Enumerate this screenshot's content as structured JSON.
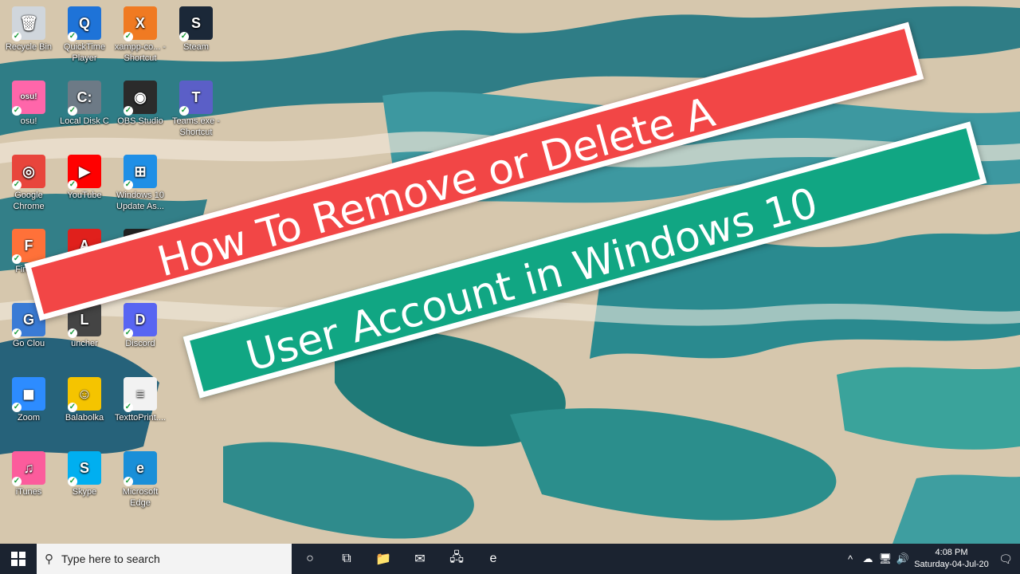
{
  "desktop": {
    "icons": [
      {
        "label": "Recycle Bin",
        "icon": "recycle-bin-icon",
        "color": "#d0d6dc",
        "glyph": "🗑"
      },
      {
        "label": "QuickTime Player",
        "icon": "quicktime-icon",
        "color": "#1e73d8",
        "glyph": "Q"
      },
      {
        "label": "xampp-co... - Shortcut",
        "icon": "xampp-icon",
        "color": "#f07a22",
        "glyph": "X"
      },
      {
        "label": "Steam",
        "icon": "steam-icon",
        "color": "#1b2838",
        "glyph": "S"
      },
      {
        "label": "osu!",
        "icon": "osu-icon",
        "color": "#ff66aa",
        "glyph": "osu!"
      },
      {
        "label": "Local Disk C",
        "icon": "local-disk-icon",
        "color": "#6d7a86",
        "glyph": "C:"
      },
      {
        "label": "OBS Studio",
        "icon": "obs-icon",
        "color": "#2b2b2b",
        "glyph": "◉"
      },
      {
        "label": "Teams.exe - Shortcut",
        "icon": "teams-icon",
        "color": "#5b5fc7",
        "glyph": "T"
      },
      {
        "label": "Google Chrome",
        "icon": "chrome-icon",
        "color": "#e8453c",
        "glyph": "◎"
      },
      {
        "label": "YouTube",
        "icon": "youtube-icon",
        "color": "#ff0000",
        "glyph": "▶"
      },
      {
        "label": "Windows 10 Update As...",
        "icon": "windows-update-icon",
        "color": "#1f8fe6",
        "glyph": "⊞"
      },
      {
        "label": "Firefox",
        "icon": "firefox-icon",
        "color": "#ff7139",
        "glyph": "F"
      },
      {
        "label": "",
        "icon": "acrobat-icon",
        "color": "#e0201c",
        "glyph": "A"
      },
      {
        "label": "",
        "icon": "epic-games-icon",
        "color": "#222",
        "glyph": "EPIC"
      },
      {
        "label": "Go Clou",
        "icon": "google-cloud-icon",
        "color": "#3a7bd5",
        "glyph": "G"
      },
      {
        "label": "uncher",
        "icon": "launcher-icon",
        "color": "#444",
        "glyph": "L"
      },
      {
        "label": "Discord",
        "icon": "discord-icon",
        "color": "#5865f2",
        "glyph": "D"
      },
      {
        "label": "Zoom",
        "icon": "zoom-icon",
        "color": "#2d8cff",
        "glyph": "◼"
      },
      {
        "label": "Balabolka",
        "icon": "balabolka-icon",
        "color": "#f5c400",
        "glyph": "☺"
      },
      {
        "label": "TexttoPrint....",
        "icon": "text-file-icon",
        "color": "#f2f2f2",
        "glyph": "≡"
      },
      {
        "label": "iTunes",
        "icon": "itunes-icon",
        "color": "#fc5c9c",
        "glyph": "♫"
      },
      {
        "label": "Skype",
        "icon": "skype-icon",
        "color": "#00aff0",
        "glyph": "S"
      },
      {
        "label": "Microsoft Edge",
        "icon": "edge-icon",
        "color": "#1a8fd8",
        "glyph": "e"
      }
    ]
  },
  "banners": {
    "line1": "How To Remove or Delete A",
    "line2": "User Account in Windows 10",
    "colors": {
      "red": "#f24646",
      "green": "#11a683"
    }
  },
  "taskbar": {
    "search_placeholder": "Type here to search",
    "buttons": [
      {
        "name": "cortana-icon",
        "glyph": "○"
      },
      {
        "name": "task-view-icon",
        "glyph": "⧉"
      },
      {
        "name": "file-explorer-icon",
        "glyph": "📁"
      },
      {
        "name": "mail-icon",
        "glyph": "✉"
      },
      {
        "name": "network-drive-icon",
        "glyph": "🖧"
      },
      {
        "name": "edge-taskbar-icon",
        "glyph": "e"
      }
    ],
    "tray": {
      "chevron": "^",
      "cloud": "☁",
      "network": "🖥",
      "volume": "🔊"
    },
    "clock": {
      "time": "4:08 PM",
      "date": "Saturday-04-Jul-20"
    },
    "notification_glyph": "🗨"
  }
}
